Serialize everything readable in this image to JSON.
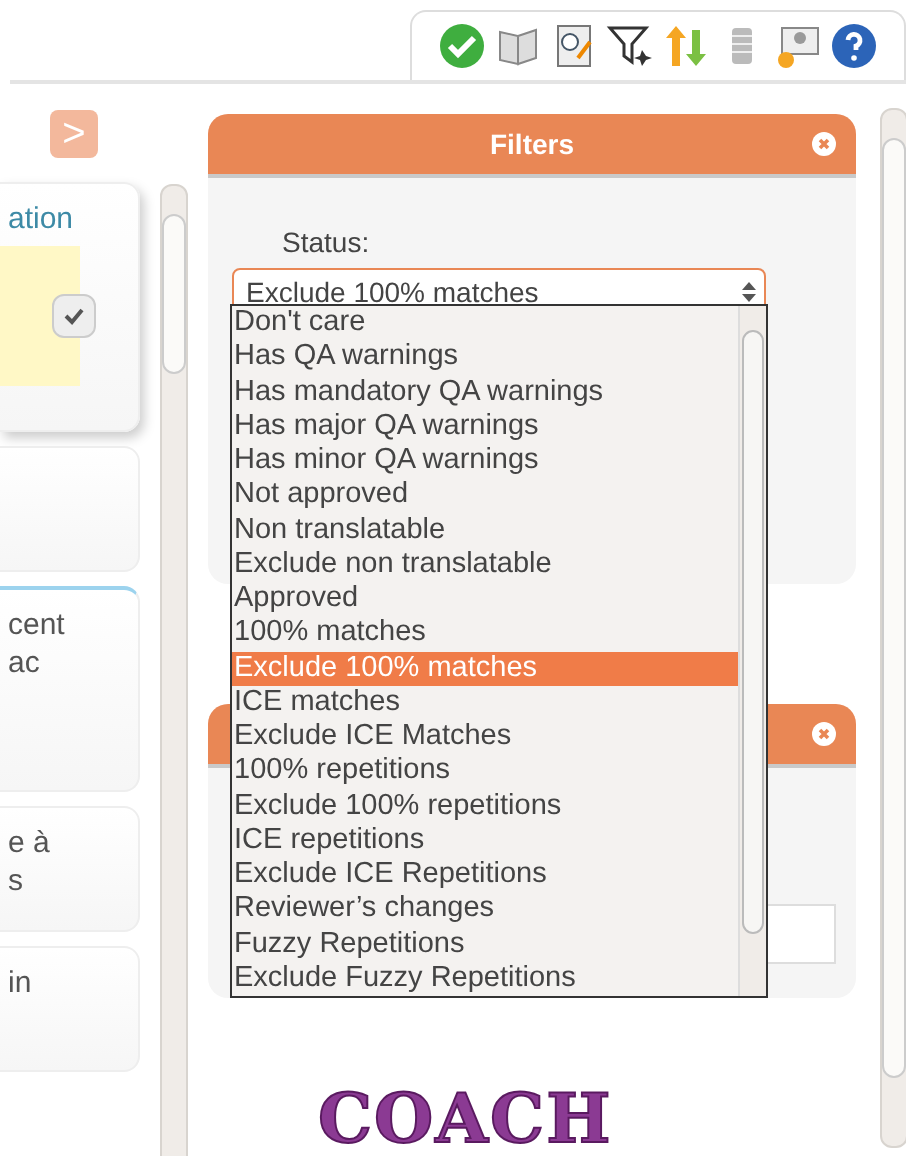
{
  "sidebar": {
    "toggle": ">",
    "cards": [
      {
        "lines": [
          "ation"
        ],
        "kind": "note"
      },
      {
        "kind": "plain"
      },
      {
        "lines": [
          "cent",
          "ac"
        ],
        "kind": "link"
      },
      {
        "lines": [
          "e à",
          "s"
        ],
        "kind": "plain"
      },
      {
        "lines": [
          "in"
        ],
        "kind": "plain"
      }
    ]
  },
  "filters": {
    "title": "Filters",
    "status_label": "Status:",
    "status_select": {
      "value": "Exclude 100% matches",
      "options": [
        {
          "label": "Don't care",
          "selected": false
        },
        {
          "label": "Has QA warnings",
          "selected": false
        },
        {
          "label": "Has mandatory QA warnings",
          "selected": false
        },
        {
          "label": "Has major QA warnings",
          "selected": false
        },
        {
          "label": "Has minor QA warnings",
          "selected": false
        },
        {
          "label": "Not approved",
          "selected": false
        },
        {
          "label": "Non translatable",
          "selected": false
        },
        {
          "label": "Exclude non translatable",
          "selected": false
        },
        {
          "label": "Approved",
          "selected": false
        },
        {
          "label": "100% matches",
          "selected": false
        },
        {
          "label": "Exclude 100% matches",
          "selected": true
        },
        {
          "label": "ICE matches",
          "selected": false
        },
        {
          "label": "Exclude ICE Matches",
          "selected": false
        },
        {
          "label": "100% repetitions",
          "selected": false
        },
        {
          "label": "Exclude 100% repetitions",
          "selected": false
        },
        {
          "label": "ICE repetitions",
          "selected": false
        },
        {
          "label": "Exclude ICE Repetitions",
          "selected": false
        },
        {
          "label": "Reviewer’s changes",
          "selected": false
        },
        {
          "label": "Fuzzy Repetitions",
          "selected": false
        },
        {
          "label": "Exclude Fuzzy Repetitions",
          "selected": false
        }
      ]
    }
  },
  "logo": "COACH"
}
